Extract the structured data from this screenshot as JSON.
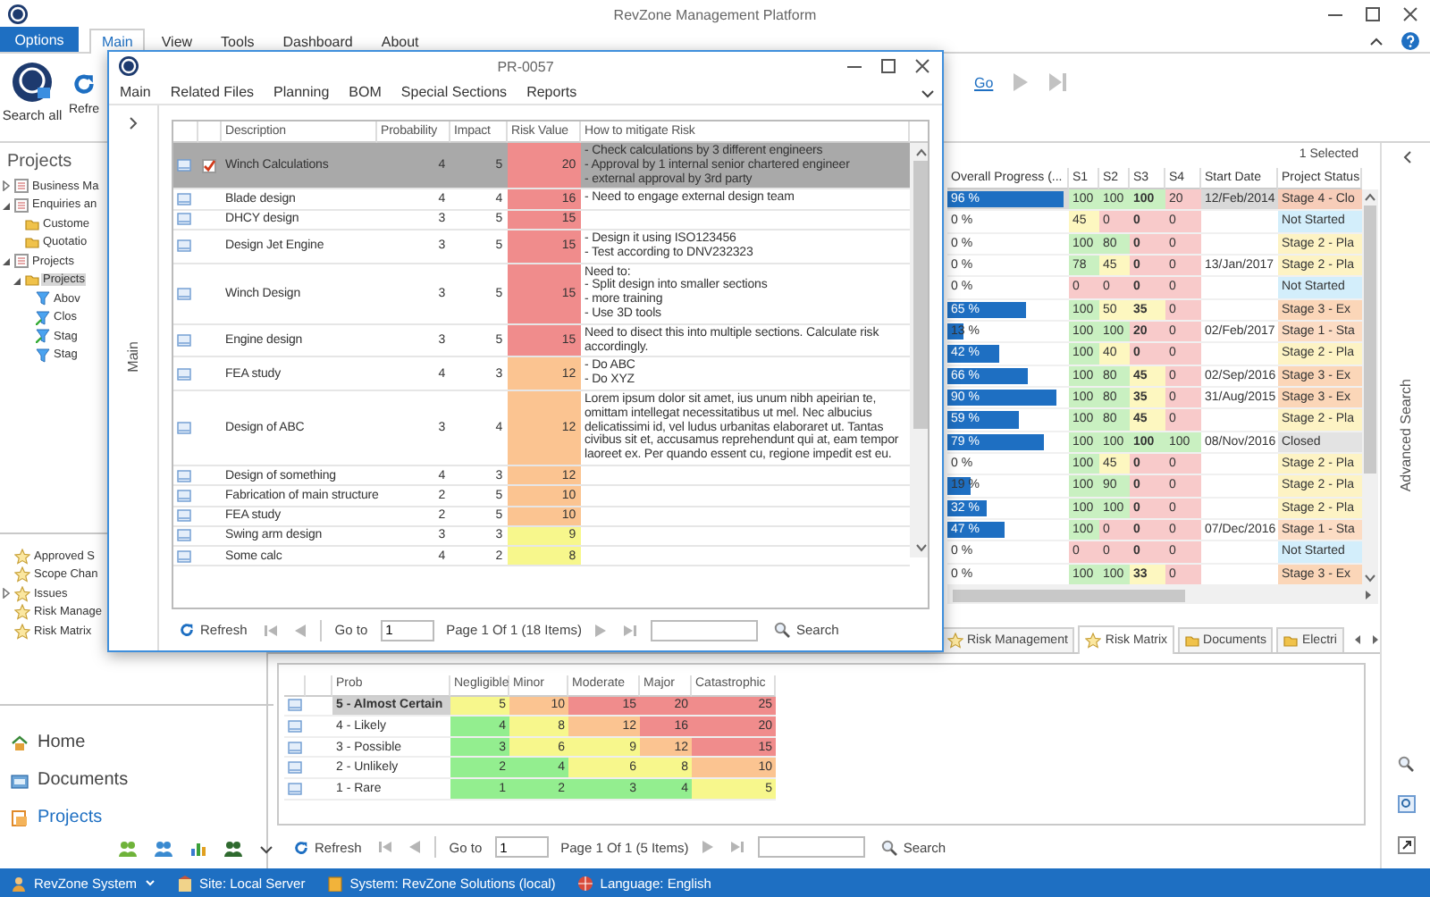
{
  "window": {
    "title": "RevZone Management Platform"
  },
  "ribbon": {
    "tabs": [
      {
        "label": "Options",
        "kind": "menu",
        "selected": false
      },
      {
        "label": "Main",
        "kind": "tab",
        "selected": true
      },
      {
        "label": "View",
        "kind": "tab",
        "selected": false
      },
      {
        "label": "Tools",
        "kind": "tab",
        "selected": false
      },
      {
        "label": "Dashboard",
        "kind": "tab",
        "selected": false
      },
      {
        "label": "About",
        "kind": "tab",
        "selected": false
      }
    ],
    "buttons": [
      {
        "label": "Search all",
        "kind": "search-all"
      },
      {
        "label": "Refre",
        "kind": "refresh"
      }
    ],
    "link": "Go"
  },
  "sidebar": {
    "title": "Projects",
    "tree": [
      {
        "label": "Business Ma",
        "kind": "group",
        "expanded": false,
        "selected": false
      },
      {
        "label": "Enquiries an",
        "kind": "group",
        "expanded": true,
        "selected": false,
        "children": [
          {
            "label": "Custome",
            "kind": "folder",
            "selected": false
          },
          {
            "label": "Quotatio",
            "kind": "folder",
            "selected": false
          }
        ]
      },
      {
        "label": "Projects",
        "kind": "group",
        "expanded": true,
        "selected": false,
        "children": [
          {
            "label": "Projects",
            "kind": "folder",
            "expanded": true,
            "selected": true,
            "children": [
              {
                "label": "Abov",
                "kind": "filter",
                "selected": false
              },
              {
                "label": "Clos",
                "kind": "filter-edit",
                "selected": false
              },
              {
                "label": "Stag",
                "kind": "filter-edit",
                "selected": false
              },
              {
                "label": "Stag",
                "kind": "filter",
                "selected": false
              }
            ]
          }
        ]
      }
    ],
    "list": [
      {
        "label": "Approved S",
        "selected": false
      },
      {
        "label": "Scope Chan",
        "selected": false
      },
      {
        "label": "Issues",
        "expanded": false,
        "selected": false
      },
      {
        "label": "Risk Manage",
        "selected": false
      },
      {
        "label": "Risk Matrix",
        "selected": false
      }
    ],
    "nav": [
      {
        "label": "Home",
        "kind": "home",
        "selected": false
      },
      {
        "label": "Documents",
        "kind": "documents",
        "selected": false
      },
      {
        "label": "Projects",
        "kind": "projects",
        "selected": true
      }
    ]
  },
  "grid": {
    "selection": "1 Selected",
    "columns": [
      "Overall Progress (...",
      "S1",
      "S2",
      "S3",
      "S4",
      "Start Date",
      "Project Status"
    ],
    "rows": [
      {
        "selected": true,
        "progress": {
          "level": 0.96,
          "text": "96 %"
        },
        "stages": [
          {
            "value": "100",
            "color": "#c9f0c1"
          },
          {
            "value": "100",
            "color": "#c9f0c1"
          },
          {
            "value": "100",
            "color": "#c9f0c1"
          },
          {
            "value": "20",
            "color": "#f8caca"
          }
        ],
        "start": "12/Feb/2014",
        "status": {
          "text": "Stage 4 - Clo",
          "color": "#f7cdb9"
        }
      },
      {
        "selected": false,
        "progress": {
          "text": "0 %"
        },
        "stages": [
          {
            "value": "45",
            "color": "#fdf7c0"
          },
          {
            "value": "0",
            "color": "#f8caca"
          },
          {
            "value": "0",
            "color": "#f8caca"
          },
          {
            "value": "0",
            "color": "#f8caca"
          }
        ],
        "start": "",
        "status": {
          "text": "Not Started",
          "color": "#d3eefb"
        }
      },
      {
        "selected": false,
        "progress": {
          "text": "0 %"
        },
        "stages": [
          {
            "value": "100",
            "color": "#c9f0c1"
          },
          {
            "value": "80",
            "color": "#c9f0c1"
          },
          {
            "value": "0",
            "color": "#f8caca"
          },
          {
            "value": "0",
            "color": "#f8caca"
          }
        ],
        "start": "",
        "status": {
          "text": "Stage 2 - Pla",
          "color": "#fdf3c4"
        }
      },
      {
        "selected": false,
        "progress": {
          "text": "0 %"
        },
        "stages": [
          {
            "value": "78",
            "color": "#c9f0c1"
          },
          {
            "value": "45",
            "color": "#fdf7c0"
          },
          {
            "value": "0",
            "color": "#f8caca"
          },
          {
            "value": "0",
            "color": "#f8caca"
          }
        ],
        "start": "13/Jan/2017",
        "status": {
          "text": "Stage 2 - Pla",
          "color": "#fdf3c4"
        }
      },
      {
        "selected": false,
        "progress": {
          "text": "0 %"
        },
        "stages": [
          {
            "value": "0",
            "color": "#f8caca"
          },
          {
            "value": "0",
            "color": "#f8caca"
          },
          {
            "value": "0",
            "color": "#f8caca"
          },
          {
            "value": "0",
            "color": "#f8caca"
          }
        ],
        "start": "",
        "status": {
          "text": "Not Started",
          "color": "#d3eefb"
        }
      },
      {
        "selected": false,
        "progress": {
          "level": 0.65,
          "text": "65 %"
        },
        "stages": [
          {
            "value": "100",
            "color": "#c9f0c1"
          },
          {
            "value": "50",
            "color": "#fdf7c0"
          },
          {
            "value": "35",
            "color": "#fdf7c0"
          },
          {
            "value": "0",
            "color": "#f8caca"
          }
        ],
        "start": "",
        "status": {
          "text": "Stage 3 - Ex",
          "color": "#fbd6b8"
        }
      },
      {
        "selected": false,
        "progress": {
          "level": 0.13,
          "text": "13 %"
        },
        "stages": [
          {
            "value": "100",
            "color": "#c9f0c1"
          },
          {
            "value": "100",
            "color": "#c9f0c1"
          },
          {
            "value": "20",
            "color": "#f8caca"
          },
          {
            "value": "0",
            "color": "#f8caca"
          }
        ],
        "start": "02/Feb/2017",
        "status": {
          "text": "Stage 1 - Sta",
          "color": "#fcdcc4"
        }
      },
      {
        "selected": false,
        "progress": {
          "level": 0.42,
          "text": "42 %"
        },
        "stages": [
          {
            "value": "100",
            "color": "#c9f0c1"
          },
          {
            "value": "40",
            "color": "#fdf7c0"
          },
          {
            "value": "0",
            "color": "#f8caca"
          },
          {
            "value": "0",
            "color": "#f8caca"
          }
        ],
        "start": "",
        "status": {
          "text": "Stage 2 - Pla",
          "color": "#fdf3c4"
        }
      },
      {
        "selected": false,
        "progress": {
          "level": 0.66,
          "text": "66 %"
        },
        "stages": [
          {
            "value": "100",
            "color": "#c9f0c1"
          },
          {
            "value": "80",
            "color": "#c9f0c1"
          },
          {
            "value": "45",
            "color": "#fdf7c0"
          },
          {
            "value": "0",
            "color": "#f8caca"
          }
        ],
        "start": "02/Sep/2016",
        "status": {
          "text": "Stage 3 - Ex",
          "color": "#fbd6b8"
        }
      },
      {
        "selected": false,
        "progress": {
          "level": 0.9,
          "text": "90 %"
        },
        "stages": [
          {
            "value": "100",
            "color": "#c9f0c1"
          },
          {
            "value": "80",
            "color": "#c9f0c1"
          },
          {
            "value": "35",
            "color": "#fdf7c0"
          },
          {
            "value": "0",
            "color": "#f8caca"
          }
        ],
        "start": "31/Aug/2015",
        "status": {
          "text": "Stage 3 - Ex",
          "color": "#fbd6b8"
        }
      },
      {
        "selected": false,
        "progress": {
          "level": 0.59,
          "text": "59 %"
        },
        "stages": [
          {
            "value": "100",
            "color": "#c9f0c1"
          },
          {
            "value": "80",
            "color": "#c9f0c1"
          },
          {
            "value": "45",
            "color": "#fdf7c0"
          },
          {
            "value": "0",
            "color": "#f8caca"
          }
        ],
        "start": "",
        "status": {
          "text": "Stage 2 - Pla",
          "color": "#fdf3c4"
        }
      },
      {
        "selected": false,
        "progress": {
          "level": 0.79,
          "text": "79 %"
        },
        "stages": [
          {
            "value": "100",
            "color": "#c9f0c1"
          },
          {
            "value": "100",
            "color": "#c9f0c1"
          },
          {
            "value": "100",
            "color": "#c9f0c1"
          },
          {
            "value": "100",
            "color": "#c9f0c1"
          }
        ],
        "start": "08/Nov/2016",
        "status": {
          "text": "Closed",
          "color": "#e3e3e3"
        }
      },
      {
        "selected": false,
        "progress": {
          "text": "0 %"
        },
        "stages": [
          {
            "value": "100",
            "color": "#c9f0c1"
          },
          {
            "value": "45",
            "color": "#fdf7c0"
          },
          {
            "value": "0",
            "color": "#f8caca"
          },
          {
            "value": "0",
            "color": "#f8caca"
          }
        ],
        "start": "",
        "status": {
          "text": "Stage 2 - Pla",
          "color": "#fdf3c4"
        }
      },
      {
        "selected": false,
        "progress": {
          "level": 0.19,
          "text": "19 %"
        },
        "stages": [
          {
            "value": "100",
            "color": "#c9f0c1"
          },
          {
            "value": "90",
            "color": "#c9f0c1"
          },
          {
            "value": "0",
            "color": "#f8caca"
          },
          {
            "value": "0",
            "color": "#f8caca"
          }
        ],
        "start": "",
        "status": {
          "text": "Stage 2 - Pla",
          "color": "#fdf3c4"
        }
      },
      {
        "selected": false,
        "progress": {
          "level": 0.32,
          "text": "32 %"
        },
        "stages": [
          {
            "value": "100",
            "color": "#c9f0c1"
          },
          {
            "value": "100",
            "color": "#c9f0c1"
          },
          {
            "value": "0",
            "color": "#f8caca"
          },
          {
            "value": "0",
            "color": "#f8caca"
          }
        ],
        "start": "",
        "status": {
          "text": "Stage 2 - Pla",
          "color": "#fdf3c4"
        }
      },
      {
        "selected": false,
        "progress": {
          "level": 0.47,
          "text": "47 %"
        },
        "stages": [
          {
            "value": "100",
            "color": "#c9f0c1"
          },
          {
            "value": "0",
            "color": "#f8caca"
          },
          {
            "value": "0",
            "color": "#f8caca"
          },
          {
            "value": "0",
            "color": "#f8caca"
          }
        ],
        "start": "07/Dec/2016",
        "status": {
          "text": "Stage 1 - Sta",
          "color": "#fcdcc4"
        }
      },
      {
        "selected": false,
        "progress": {
          "text": "0 %"
        },
        "stages": [
          {
            "value": "0",
            "color": "#f8caca"
          },
          {
            "value": "0",
            "color": "#f8caca"
          },
          {
            "value": "0",
            "color": "#f8caca"
          },
          {
            "value": "0",
            "color": "#f8caca"
          }
        ],
        "start": "",
        "status": {
          "text": "Not Started",
          "color": "#d3eefb"
        }
      },
      {
        "selected": false,
        "progress": {
          "text": "0 %"
        },
        "stages": [
          {
            "value": "100",
            "color": "#c9f0c1"
          },
          {
            "value": "100",
            "color": "#c9f0c1"
          },
          {
            "value": "33",
            "color": "#fdf7c0"
          },
          {
            "value": "0",
            "color": "#f8caca"
          }
        ],
        "start": "",
        "status": {
          "text": "Stage 3 - Ex",
          "color": "#fbd6b8"
        }
      }
    ]
  },
  "tabs": [
    {
      "label": "Risk Management",
      "kind": "star",
      "selected": false
    },
    {
      "label": "Risk Matrix",
      "kind": "star",
      "selected": true
    },
    {
      "label": "Documents",
      "kind": "folder",
      "selected": false
    },
    {
      "label": "Electri",
      "kind": "folder",
      "selected": false
    }
  ],
  "matrix": {
    "columns": [
      "Prob",
      "Negligible",
      "Minor",
      "Moderate",
      "Major",
      "Catastrophic"
    ],
    "rows": [
      {
        "selected": true,
        "cells": [
          {
            "value": "5 - Almost Certain"
          },
          {
            "value": "5",
            "color": "#f7f78c"
          },
          {
            "value": "10",
            "color": "#fbc491"
          },
          {
            "value": "15",
            "color": "#f08c8c"
          },
          {
            "value": "20",
            "color": "#f08c8c"
          },
          {
            "value": "25",
            "color": "#f08c8c"
          }
        ]
      },
      {
        "selected": false,
        "cells": [
          {
            "value": "4 - Likely"
          },
          {
            "value": "4",
            "color": "#93ee8f"
          },
          {
            "value": "8",
            "color": "#f7f78c"
          },
          {
            "value": "12",
            "color": "#fbc491"
          },
          {
            "value": "16",
            "color": "#f08c8c"
          },
          {
            "value": "20",
            "color": "#f08c8c"
          }
        ]
      },
      {
        "selected": false,
        "cells": [
          {
            "value": "3 - Possible"
          },
          {
            "value": "3",
            "color": "#93ee8f"
          },
          {
            "value": "6",
            "color": "#f7f78c"
          },
          {
            "value": "9",
            "color": "#f7f78c"
          },
          {
            "value": "12",
            "color": "#fbc491"
          },
          {
            "value": "15",
            "color": "#f08c8c"
          }
        ]
      },
      {
        "selected": false,
        "cells": [
          {
            "value": "2 - Unlikely"
          },
          {
            "value": "2",
            "color": "#93ee8f"
          },
          {
            "value": "4",
            "color": "#93ee8f"
          },
          {
            "value": "6",
            "color": "#f7f78c"
          },
          {
            "value": "8",
            "color": "#f7f78c"
          },
          {
            "value": "10",
            "color": "#fbc491"
          }
        ]
      },
      {
        "selected": false,
        "cells": [
          {
            "value": "1 - Rare"
          },
          {
            "value": "1",
            "color": "#93ee8f"
          },
          {
            "value": "2",
            "color": "#93ee8f"
          },
          {
            "value": "3",
            "color": "#93ee8f"
          },
          {
            "value": "4",
            "color": "#93ee8f"
          },
          {
            "value": "5",
            "color": "#f7f78c"
          }
        ]
      }
    ]
  },
  "pager": {
    "refresh": "Refresh",
    "goto": "Go to",
    "page": "1",
    "info": "Page 1 Of 1 (5 Items)",
    "search": "Search"
  },
  "side_panel": {
    "title": "Advanced Search"
  },
  "status_bar": {
    "items": [
      {
        "label": "RevZone System",
        "kind": "user"
      },
      {
        "label": "Site: Local Server",
        "kind": "site"
      },
      {
        "label": "System: RevZone Solutions (local)",
        "kind": "system"
      },
      {
        "label": "Language: English",
        "kind": "language"
      }
    ]
  },
  "dialog": {
    "title": "PR-0057",
    "menu": [
      "Main",
      "Related Files",
      "Planning",
      "BOM",
      "Special Sections",
      "Reports"
    ],
    "side_title": "Main",
    "columns": [
      "Description",
      "Probability",
      "Impact",
      "Risk Value",
      "How to mitigate Risk"
    ],
    "rows": [
      {
        "selected": true,
        "checked": true,
        "description": "Winch Calculations",
        "probability": "4",
        "impact": "5",
        "risk": "20",
        "color": "#f08c8c",
        "mitigation": "- Check calculations by 3 different engineers\n- Approval by 1 internal senior chartered engineer\n- external approval by 3rd party"
      },
      {
        "selected": false,
        "checked": false,
        "description": "Blade design",
        "probability": "4",
        "impact": "4",
        "risk": "16",
        "color": "#f08c8c",
        "mitigation": "- Need to engage external design team"
      },
      {
        "selected": false,
        "checked": false,
        "description": "DHCY design",
        "probability": "3",
        "impact": "5",
        "risk": "15",
        "color": "#f08c8c",
        "mitigation": ""
      },
      {
        "selected": false,
        "checked": false,
        "description": "Design Jet Engine",
        "probability": "3",
        "impact": "5",
        "risk": "15",
        "color": "#f08c8c",
        "mitigation": "- Design it using ISO123456\n- Test according to DNV232323"
      },
      {
        "selected": false,
        "checked": false,
        "description": "Winch Design",
        "probability": "3",
        "impact": "5",
        "risk": "15",
        "color": "#f08c8c",
        "mitigation": "Need to:\n- Split design into smaller sections\n- more training\n- Use 3D tools"
      },
      {
        "selected": false,
        "checked": false,
        "description": "Engine design",
        "probability": "3",
        "impact": "5",
        "risk": "15",
        "color": "#f08c8c",
        "mitigation": "Need to disect this into multiple sections. Calculate risk accordingly."
      },
      {
        "selected": false,
        "checked": false,
        "description": "FEA study",
        "probability": "4",
        "impact": "3",
        "risk": "12",
        "color": "#fbc491",
        "mitigation": "- Do ABC\n- Do XYZ"
      },
      {
        "selected": false,
        "checked": false,
        "description": "Design of ABC",
        "probability": "3",
        "impact": "4",
        "risk": "12",
        "color": "#fbc491",
        "mitigation": "Lorem ipsum dolor sit amet, ius unum nibh apeirian te, omittam intellegat necessitatibus ut mel. Nec albucius delicatissimi id, vel ludus urbanitas elaboraret ut. Tantas civibus sit et, accusamus reprehendunt qui at, eam tempor laoreet ex. Per quando essent cu, regione impedit est eu."
      },
      {
        "selected": false,
        "checked": false,
        "description": "Design of something",
        "probability": "4",
        "impact": "3",
        "risk": "12",
        "color": "#fbc491",
        "mitigation": ""
      },
      {
        "selected": false,
        "checked": false,
        "description": "Fabrication of main structure",
        "probability": "2",
        "impact": "5",
        "risk": "10",
        "color": "#fbc491",
        "mitigation": ""
      },
      {
        "selected": false,
        "checked": false,
        "description": "FEA study",
        "probability": "2",
        "impact": "5",
        "risk": "10",
        "color": "#fbc491",
        "mitigation": ""
      },
      {
        "selected": false,
        "checked": false,
        "description": "Swing arm design",
        "probability": "3",
        "impact": "3",
        "risk": "9",
        "color": "#f7f78c",
        "mitigation": ""
      },
      {
        "selected": false,
        "checked": false,
        "description": "Some calc",
        "probability": "4",
        "impact": "2",
        "risk": "8",
        "color": "#f7f78c",
        "mitigation": ""
      }
    ],
    "pager": {
      "refresh": "Refresh",
      "goto": "Go to",
      "page": "1",
      "info": "Page 1 Of 1 (18 Items)",
      "search": "Search"
    }
  }
}
